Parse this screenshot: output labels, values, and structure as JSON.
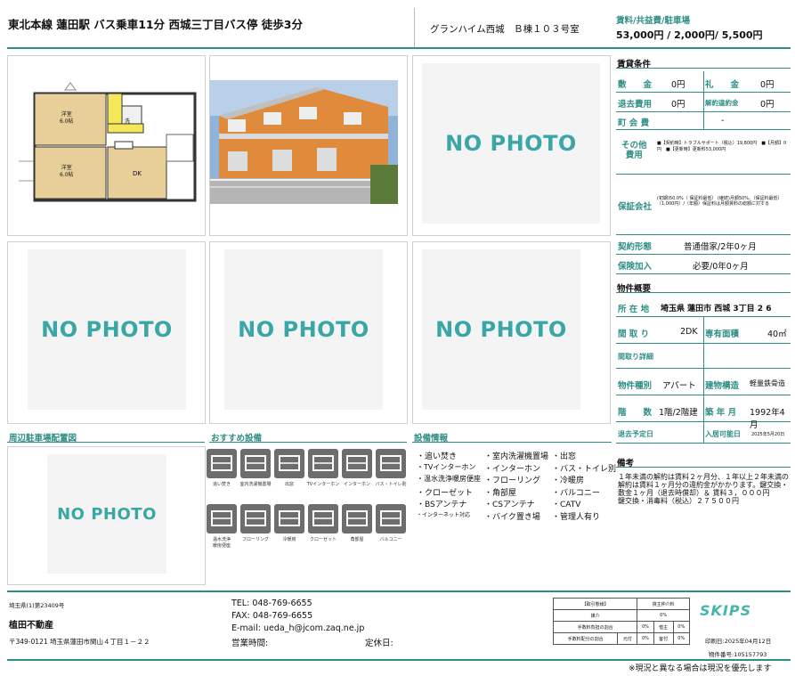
{
  "header": {
    "access": "東北本線 蓮田駅 バス乗車11分 西城三丁目バス停 徒歩3分",
    "building": "グランハイム西城　Ｂ棟１０３号室",
    "rent_label": "賃料/共益費/駐車場",
    "rent_value": "53,000円 / 2,000円/ 5,500円"
  },
  "photos": {
    "nophoto_text": "NO PHOTO"
  },
  "floorplan": {
    "room1": "洋室\n6.0帖",
    "room2": "洋室\n6.0帖",
    "dk": "DK",
    "wash": "洗"
  },
  "sections": {
    "parking": "周辺駐車場配置図",
    "recommend": "おすすめ設備",
    "equipment": "設備情報"
  },
  "recommend_tiles": [
    {
      "icon": "bathtub-icon",
      "caption": "追い焚き"
    },
    {
      "icon": "washer-icon",
      "caption": "室内洗濯機置場"
    },
    {
      "icon": "window-icon",
      "caption": "出窓"
    },
    {
      "icon": "intercom-tv-icon",
      "caption": "TVインターホン"
    },
    {
      "icon": "intercom-icon",
      "caption": "インターホン"
    },
    {
      "icon": "bath-toilet-icon",
      "caption": "バス・トイレ別"
    },
    {
      "icon": "toilet-icon",
      "caption": "温水洗浄\n暖房便座"
    },
    {
      "icon": "flooring-icon",
      "caption": "フローリング"
    },
    {
      "icon": "aircon-icon",
      "caption": "冷暖房"
    },
    {
      "icon": "closet-icon",
      "caption": "クローゼット"
    },
    {
      "icon": "corner-room-icon",
      "caption": "角部屋"
    },
    {
      "icon": "balcony-icon",
      "caption": "バルコニー"
    }
  ],
  "equipment_items": [
    [
      "・追い焚き",
      "・室内洗濯機置場",
      "・出窓"
    ],
    [
      "・TVインターホン",
      "・インターホン",
      "・バス・トイレ別"
    ],
    [
      "・温水洗浄暖房便座",
      "・フローリング",
      "・冷暖房"
    ],
    [
      "・クローゼット",
      "・角部屋",
      "・バルコニー"
    ],
    [
      "・BSアンテナ",
      "・CSアンテナ",
      "・CATV"
    ],
    [
      "・インターネット対応",
      "・バイク置き場",
      "・管理人有り"
    ]
  ],
  "rental": {
    "title": "賃貸条件",
    "shikikin_k": "敷　　金",
    "shikikin_v": "0円",
    "reikin_k": "礼　　金",
    "reikin_v": "0円",
    "taikyo_k": "退去費用",
    "taikyo_v": "0円",
    "kaiyaku_k": "解約違約金",
    "kaiyaku_v": "0円",
    "chokai_k": "町 会 費",
    "chokai_v": "-",
    "other_k": "その他\n費用",
    "other_v": "■【契約時】トラブルサポート（税込）19,800円　■【月額】0円　■【更新時】更新料53,000円",
    "guarantee_k": "保証会社",
    "guarantee_v": "(初期)50.0%（ 保証料最低） (継続)月額50%、（保証料最低）（1,000円）/（年額）保証料は月額賃料の総額に対する",
    "contract_k": "契約形態",
    "contract_v": "普通借家/2年0ヶ月",
    "insurance_k": "保険加入",
    "insurance_v": "必要/0年0ヶ月"
  },
  "property": {
    "title": "物件概要",
    "address_k": "所 在 地",
    "address_v": "埼玉県 蓮田市 西城 3丁目 2 6",
    "layout_k": "間 取 り",
    "layout_v": "2DK",
    "area_k": "専有面積",
    "area_v": "40㎡",
    "detail_k": "間取り詳細",
    "type_k": "物件種別",
    "type_v": "アパート",
    "structure_k": "建物構造",
    "structure_v": "軽量鉄骨造",
    "floor_k": "階　　数",
    "floor_v": "1階/2階建",
    "built_k": "築 年 月",
    "built_v": "1992年4月",
    "moveout_k": "退去予定日",
    "available_k": "入居可能日",
    "available_v": "2025年5月20日"
  },
  "remarks": {
    "title": "備考",
    "text": "１年未満の解約は賃料２ヶ月分、１年以上２年未満の解約は賃料１ヶ月分の違約金がかかります。鍵交換・敷金１ヶ月（退去時償却）＆ 賃料３，０００円\n鍵交換・消毒料（税込）２７５００円"
  },
  "footer": {
    "license": "埼玉県(1)第23409号",
    "company": "植田不動産",
    "address": "〒349-0121 埼玉県蓮田市関山４丁目１－２２",
    "tel": "TEL: 048-769-6655",
    "fax": "FAX: 048-769-6655",
    "email": "E-mail: ueda_h@jcom.zaq.ne.jp",
    "hours_label": "営業時間:",
    "holiday_label": "定休日:",
    "logo": "SKIPS",
    "print_date": "印刷日:2025年04月12日",
    "property_no": "物件番号:105157793",
    "note": "※現況と異なる場合は現況を優先します"
  },
  "tax_table": {
    "h1": "【取引態様】",
    "h2": "貸主仲介料",
    "r1": "媒介",
    "r1v": "0%",
    "r2a": "手数料負担の割合",
    "r2b": "0%",
    "r2c": "借主",
    "r2d": "0%",
    "r3a": "手数料配分の割合",
    "r3b": "元付",
    "r3c": "0%",
    "r3d": "客付",
    "r3e": "0%"
  },
  "colors": {
    "accent": "#2f8f86",
    "nophoto_text": "#3aa6a6"
  }
}
